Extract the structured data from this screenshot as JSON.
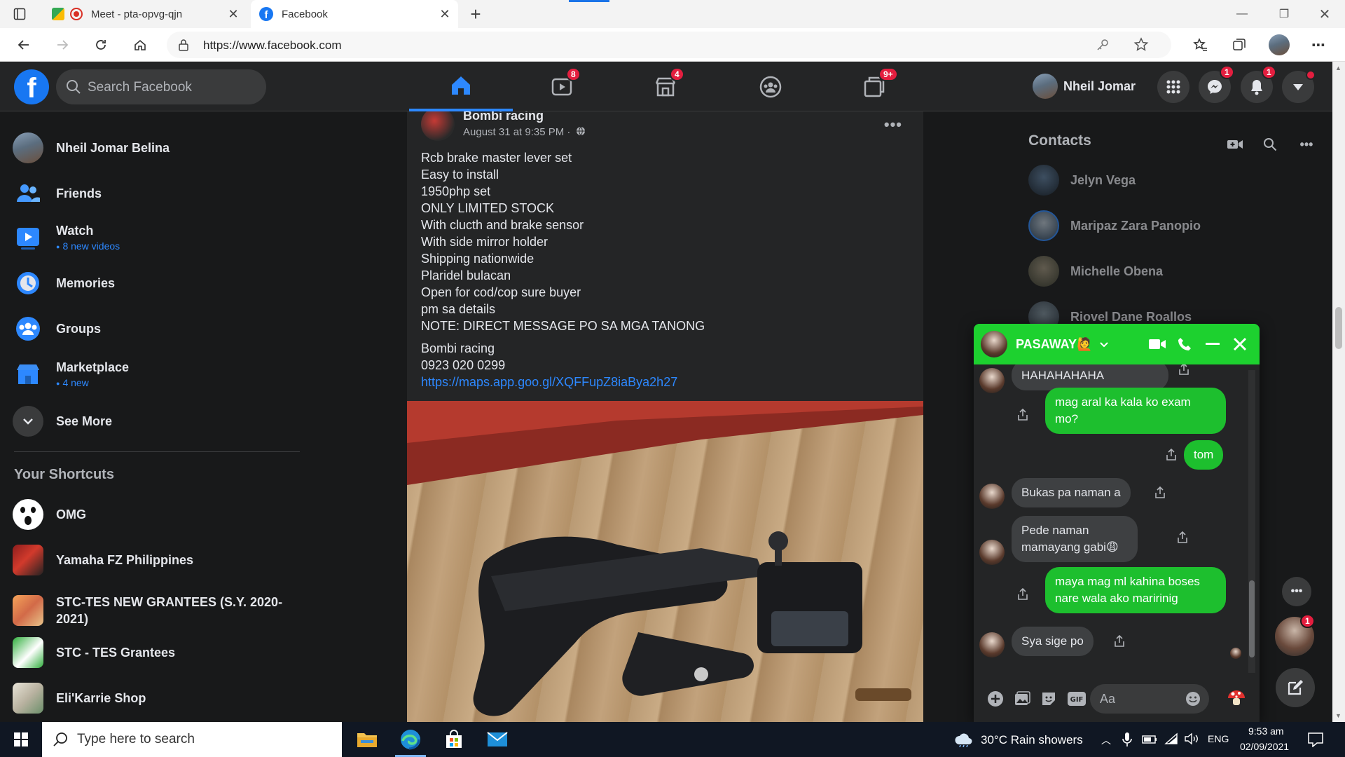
{
  "browser": {
    "tabs": [
      {
        "title": "Meet - pta-opvg-qjn",
        "active": false
      },
      {
        "title": "Facebook",
        "active": true
      }
    ],
    "url": "https://www.facebook.com"
  },
  "topbar": {
    "search_placeholder": "Search Facebook",
    "nav_badges": {
      "watch": "8",
      "marketplace": "4",
      "gaming": "9+"
    },
    "profile_name": "Nheil Jomar",
    "messenger_badge": "1",
    "notifications_badge": "1",
    "accent_color": "#2d88ff"
  },
  "sidebar": {
    "profile_name": "Nheil Jomar Belina",
    "items": [
      {
        "label": "Friends",
        "sub": ""
      },
      {
        "label": "Watch",
        "sub": "8 new videos"
      },
      {
        "label": "Memories",
        "sub": ""
      },
      {
        "label": "Groups",
        "sub": ""
      },
      {
        "label": "Marketplace",
        "sub": "4 new"
      },
      {
        "label": "See More",
        "sub": ""
      }
    ],
    "shortcuts_title": "Your Shortcuts",
    "shortcuts": [
      {
        "label": "OMG"
      },
      {
        "label": "Yamaha FZ Philippines"
      },
      {
        "label": "STC-TES NEW GRANTEES (S.Y. 2020-2021)"
      },
      {
        "label": "STC - TES Grantees"
      },
      {
        "label": "Eli'Karrie Shop"
      }
    ]
  },
  "post": {
    "author": "Bombi racing",
    "time": "August 31 at 9:35 PM ·",
    "lines": [
      "Rcb brake master lever set",
      "Easy to install",
      "1950php set",
      "ONLY LIMITED STOCK",
      "With clucth and brake sensor",
      "With side mirror holder",
      "Shipping nationwide",
      "Plaridel bulacan",
      "Open for cod/cop sure buyer",
      "pm sa details",
      "NOTE: DIRECT MESSAGE PO SA MGA TANONG"
    ],
    "footer_name": "Bombi racing",
    "phone": "0923 020 0299",
    "link": "https://maps.app.goo.gl/XQFFupZ8iaBya2h27"
  },
  "contacts": {
    "title": "Contacts",
    "list": [
      {
        "name": "Jelyn Vega"
      },
      {
        "name": "Maripaz Zara Panopio"
      },
      {
        "name": "Michelle Obena"
      },
      {
        "name": "Riovel Dane Roallos"
      }
    ]
  },
  "chat": {
    "name": "PASAWAY🙋",
    "header_color": "#1dd12f",
    "messages": [
      {
        "from": "them",
        "text": "HAHAHAHAHA"
      },
      {
        "from": "me",
        "text": "mag aral ka kala ko exam mo?"
      },
      {
        "from": "me",
        "text": "tom"
      },
      {
        "from": "them",
        "text": "Bukas pa naman a"
      },
      {
        "from": "them",
        "text": "Pede naman mamayang gabi😩"
      },
      {
        "from": "me",
        "text": "maya mag ml kahina boses nare wala ako maririnig"
      },
      {
        "from": "them",
        "text": "Sya sige po"
      }
    ],
    "input_placeholder": "Aa",
    "floating_badge": "1"
  },
  "taskbar": {
    "search_placeholder": "Type here to search",
    "weather": "30°C  Rain showers",
    "lang": "ENG",
    "time": "9:53 am",
    "date": "02/09/2021"
  }
}
